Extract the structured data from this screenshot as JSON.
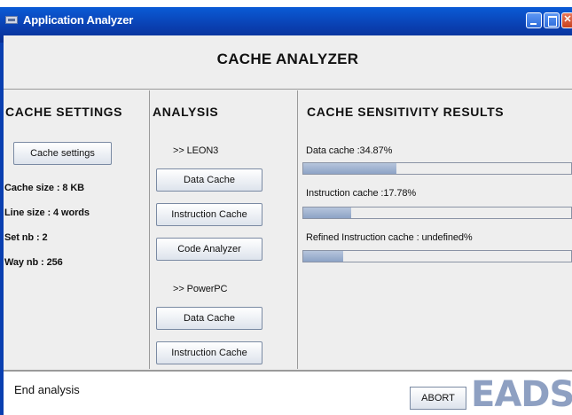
{
  "window": {
    "title": "Application Analyzer",
    "header": "CACHE ANALYZER"
  },
  "settings": {
    "title": "CACHE SETTINGS",
    "button": "Cache settings",
    "rows": [
      "Cache size  :  8 KB",
      "Line size  :  4 words",
      "Set nb    :  2",
      "Way nb   :  256"
    ]
  },
  "analysis": {
    "title": "ANALYSIS",
    "groups": [
      {
        "label": ">> LEON3",
        "buttons": [
          "Data Cache",
          "Instruction Cache",
          "Code Analyzer"
        ]
      },
      {
        "label": ">> PowerPC",
        "buttons": [
          "Data Cache",
          "Instruction Cache"
        ]
      }
    ]
  },
  "results": {
    "title": "CACHE SENSITIVITY RESULTS",
    "items": [
      {
        "label": "Data cache :34.87%",
        "progress": 0.3487
      },
      {
        "label": "Instruction cache :17.78%",
        "progress": 0.1778
      },
      {
        "label": "Refined Instruction cache : undefined%",
        "progress": 0.15
      }
    ]
  },
  "status": {
    "text": "End analysis",
    "abort": "ABORT",
    "logo": "EADS"
  },
  "colors": {
    "titlebar": "#0a3fb0",
    "progress_fill": "#8da3c6",
    "logo": "#8ea0c2"
  }
}
